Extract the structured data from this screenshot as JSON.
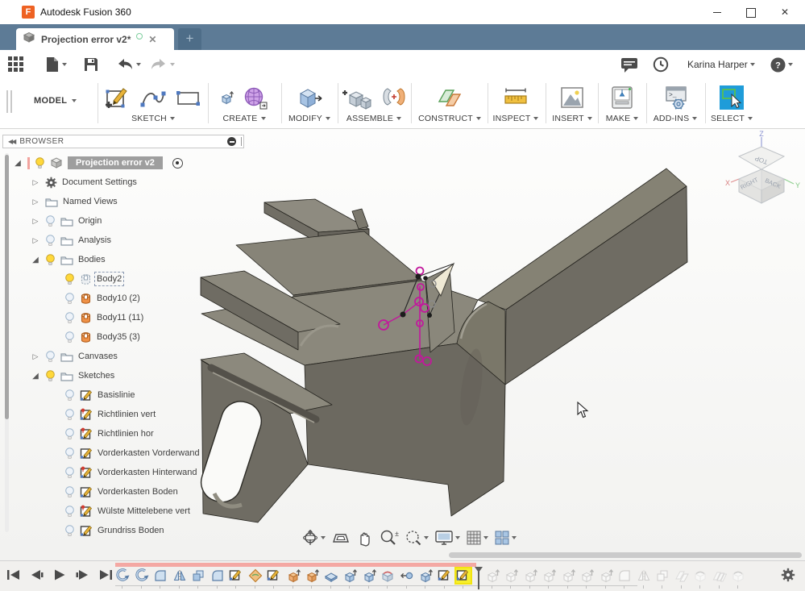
{
  "window": {
    "title": "Autodesk Fusion 360"
  },
  "tabs": {
    "active_title": "Projection error v2*",
    "new_tab_label": "+"
  },
  "quickbar": {
    "left_icons": [
      "app-grid",
      "file-new",
      "save",
      "undo",
      "redo"
    ],
    "right_icons": [
      "comments",
      "job-status"
    ],
    "user_name": "Karina Harper",
    "help_label": "?"
  },
  "ribbon": {
    "workspace_label": "MODEL",
    "groups": [
      {
        "label": "SKETCH",
        "icons": [
          "create-sketch",
          "spline",
          "rectangle"
        ]
      },
      {
        "label": "CREATE",
        "icons": [
          "extrude",
          "form"
        ]
      },
      {
        "label": "MODIFY",
        "icons": [
          "press-pull"
        ]
      },
      {
        "label": "ASSEMBLE",
        "icons": [
          "new-component",
          "joint"
        ]
      },
      {
        "label": "CONSTRUCT",
        "icons": [
          "construct-plane"
        ]
      },
      {
        "label": "INSPECT",
        "icons": [
          "measure"
        ]
      },
      {
        "label": "INSERT",
        "icons": [
          "insert-image"
        ]
      },
      {
        "label": "MAKE",
        "icons": [
          "print-3d"
        ]
      },
      {
        "label": "ADD-INS",
        "icons": [
          "scripts-addins"
        ]
      },
      {
        "label": "SELECT",
        "icons": [
          "select"
        ]
      }
    ]
  },
  "browser": {
    "header": "BROWSER",
    "items": [
      {
        "label": "Projection error v2",
        "level": 0,
        "icon": "component",
        "bulb": "on",
        "expand": "expanded",
        "selected": true,
        "radio": true
      },
      {
        "label": "Document Settings",
        "level": 1,
        "icon": "gear",
        "bulb": "none",
        "expand": "collapsed"
      },
      {
        "label": "Named Views",
        "level": 1,
        "icon": "folder",
        "bulb": "none",
        "expand": "collapsed"
      },
      {
        "label": "Origin",
        "level": 1,
        "icon": "folder",
        "bulb": "off",
        "expand": "collapsed"
      },
      {
        "label": "Analysis",
        "level": 1,
        "icon": "folder",
        "bulb": "off",
        "expand": "collapsed"
      },
      {
        "label": "Bodies",
        "level": 1,
        "icon": "folder",
        "bulb": "on",
        "expand": "expanded"
      },
      {
        "label": "Body2",
        "level": 2,
        "icon": "body-ghost",
        "bulb": "on",
        "expand": "none",
        "ants": true
      },
      {
        "label": "Body10 (2)",
        "level": 2,
        "icon": "body",
        "bulb": "off",
        "expand": "none"
      },
      {
        "label": "Body11 (11)",
        "level": 2,
        "icon": "body",
        "bulb": "off",
        "expand": "none"
      },
      {
        "label": "Body35 (3)",
        "level": 2,
        "icon": "body",
        "bulb": "off",
        "expand": "none"
      },
      {
        "label": "Canvases",
        "level": 1,
        "icon": "folder",
        "bulb": "off",
        "expand": "collapsed"
      },
      {
        "label": "Sketches",
        "level": 1,
        "icon": "folder",
        "bulb": "on",
        "expand": "expanded"
      },
      {
        "label": "Basislinie",
        "level": 2,
        "icon": "sketch",
        "bulb": "off",
        "expand": "none"
      },
      {
        "label": "Richtlinien vert",
        "level": 2,
        "icon": "sketch-pin",
        "bulb": "off",
        "expand": "none"
      },
      {
        "label": "Richtlinien hor",
        "level": 2,
        "icon": "sketch-pin",
        "bulb": "off",
        "expand": "none"
      },
      {
        "label": "Vorderkasten Vorderwand",
        "level": 2,
        "icon": "sketch",
        "bulb": "off",
        "expand": "none"
      },
      {
        "label": "Vorderkasten Hinterwand",
        "level": 2,
        "icon": "sketch-pin",
        "bulb": "off",
        "expand": "none"
      },
      {
        "label": "Vorderkasten Boden",
        "level": 2,
        "icon": "sketch",
        "bulb": "off",
        "expand": "none"
      },
      {
        "label": "Wülste Mittelebene vert",
        "level": 2,
        "icon": "sketch-pin",
        "bulb": "off",
        "expand": "none"
      },
      {
        "label": "Grundriss Boden",
        "level": 2,
        "icon": "sketch",
        "bulb": "off",
        "expand": "none"
      }
    ]
  },
  "viewcube": {
    "faces": {
      "top": "TOP",
      "right": "RIGHT",
      "back": "BACK"
    },
    "axes": {
      "x": "X",
      "y": "Y",
      "z": "Z"
    }
  },
  "navbar": {
    "icons": [
      {
        "name": "orbit",
        "dropdown": true
      },
      {
        "name": "look-at",
        "dropdown": false
      },
      {
        "name": "pan",
        "dropdown": false
      },
      {
        "name": "zoom",
        "dropdown": false
      },
      {
        "name": "zoom-window",
        "dropdown": true
      },
      {
        "name": "display-settings",
        "dropdown": true
      },
      {
        "name": "grid-layout",
        "dropdown": true
      },
      {
        "name": "viewports",
        "dropdown": true
      }
    ]
  },
  "timeline": {
    "playback": [
      "go-to-start",
      "step-back",
      "play",
      "step-forward",
      "go-to-end"
    ],
    "features": [
      {
        "type": "revolve",
        "state": "normal"
      },
      {
        "type": "revolve",
        "state": "normal"
      },
      {
        "type": "fillet",
        "state": "normal"
      },
      {
        "type": "mirror",
        "state": "normal"
      },
      {
        "type": "combine",
        "state": "normal"
      },
      {
        "type": "fillet",
        "state": "normal"
      },
      {
        "type": "sketch",
        "state": "normal"
      },
      {
        "type": "patch",
        "state": "normal"
      },
      {
        "type": "sketch",
        "state": "normal"
      },
      {
        "type": "extrude-join",
        "state": "normal"
      },
      {
        "type": "extrude-join",
        "state": "normal"
      },
      {
        "type": "offset-face",
        "state": "normal"
      },
      {
        "type": "extrude",
        "state": "normal"
      },
      {
        "type": "extrude",
        "state": "normal"
      },
      {
        "type": "project",
        "state": "normal"
      },
      {
        "type": "point",
        "state": "normal"
      },
      {
        "type": "extrude",
        "state": "normal"
      },
      {
        "type": "sketch",
        "state": "normal"
      },
      {
        "type": "sketch",
        "state": "active"
      },
      {
        "type": "extrude",
        "state": "future"
      },
      {
        "type": "extrude",
        "state": "future"
      },
      {
        "type": "extrude",
        "state": "future"
      },
      {
        "type": "extrude",
        "state": "future"
      },
      {
        "type": "extrude",
        "state": "future"
      },
      {
        "type": "extrude",
        "state": "future"
      },
      {
        "type": "extrude",
        "state": "future"
      },
      {
        "type": "fillet",
        "state": "future"
      },
      {
        "type": "mirror",
        "state": "future"
      },
      {
        "type": "combine",
        "state": "future"
      },
      {
        "type": "construct-plane",
        "state": "future"
      },
      {
        "type": "project",
        "state": "future"
      },
      {
        "type": "midplane",
        "state": "future"
      },
      {
        "type": "project",
        "state": "future"
      }
    ]
  },
  "colors": {
    "tabbar": "#5d7b96",
    "accent_blue": "#1f9cd9",
    "rollback_pink": "#f4a8a3",
    "highlight_yellow": "#f7ef2e",
    "sketch_magenta": "#c2189c"
  }
}
